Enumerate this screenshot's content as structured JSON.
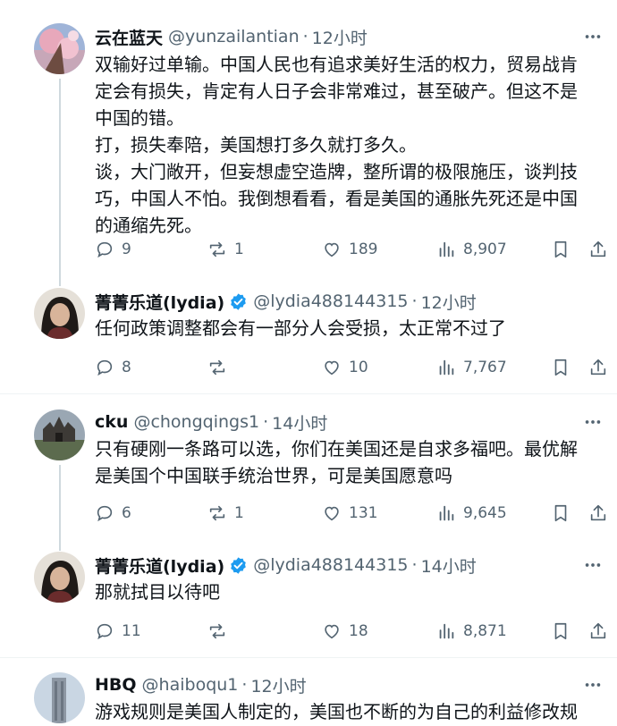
{
  "posts": [
    {
      "author_name": "云在蓝天",
      "handle": "@yunzailantian",
      "separator": "·",
      "time": "12小时",
      "body": "双输好过单输。中国人民也有追求美好生活的权力，贸易战肯\n定会有损失，肯定有人日子会非常难过，甚至破产。但这不是\n中国的错。\n打，损失奉陪，美国想打多久就打多久。\n谈，大门敞开，但妄想虚空造牌，整所谓的极限施压，谈判技\n巧，中国人不怕。我倒想看看，看是美国的通胀先死还是中国\n的通缩先死。",
      "replies": "9",
      "reposts": "1",
      "likes": "189",
      "views": "8,907"
    },
    {
      "author_name": "菁菁乐道(lydia)",
      "handle": "@lydia488144315",
      "separator": "·",
      "time": "12小时",
      "body": "任何政策调整都会有一部分人会受损，太正常不过了",
      "replies": "8",
      "reposts": "",
      "likes": "10",
      "views": "7,767"
    },
    {
      "author_name": "cku",
      "handle": "@chongqings1",
      "separator": "·",
      "time": "14小时",
      "body": "只有硬刚一条路可以选，你们在美国还是自求多福吧。最优解\n是美国个中国联手统治世界，可是美国愿意吗",
      "replies": "6",
      "reposts": "1",
      "likes": "131",
      "views": "9,645"
    },
    {
      "author_name": "菁菁乐道(lydia)",
      "handle": "@lydia488144315",
      "separator": "·",
      "time": "14小时",
      "body": "那就拭目以待吧",
      "replies": "11",
      "reposts": "",
      "likes": "18",
      "views": "8,871"
    },
    {
      "author_name": "HBQ",
      "handle": "@haiboqu1",
      "separator": "·",
      "time": "12小时",
      "body": "游戏规则是美国人制定的，美国也不断的为自己的利益修改规"
    }
  ],
  "icons": {
    "reply": "reply-icon",
    "repost": "repost-icon",
    "like": "heart-icon",
    "views": "views-icon",
    "bookmark": "bookmark-icon",
    "share": "share-icon",
    "more": "more-icon",
    "verified": "verified-badge-icon"
  },
  "colors": {
    "text": "#0f1419",
    "secondary": "#536471",
    "verified": "#1d9bf0",
    "thread_line": "#cfd9de",
    "divider": "#eff3f4"
  }
}
